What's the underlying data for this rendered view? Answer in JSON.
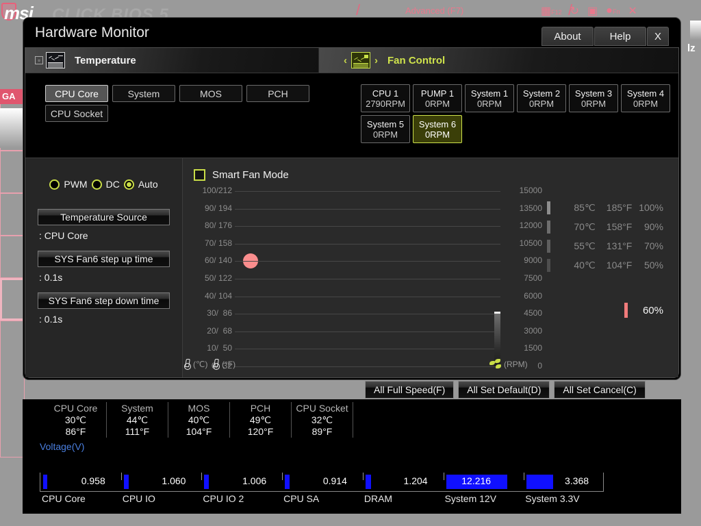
{
  "background": {
    "brand": "msi",
    "brand_sub": "CLICK BIOS 5",
    "advanced_label": "Advanced (F7)",
    "screenshot_key": "F12",
    "fn_label": "Fn",
    "ga_tag": "GA",
    "right_edge_text": "lz"
  },
  "dialog": {
    "title": "Hardware Monitor",
    "buttons": [
      {
        "label": "About",
        "name": "about-button"
      },
      {
        "label": "Help",
        "name": "help-button"
      },
      {
        "label": "X",
        "name": "close-button"
      }
    ]
  },
  "temperature_panel": {
    "header": "Temperature",
    "collapse_glyph": "⊡",
    "tabs": [
      {
        "label": "CPU Core",
        "selected": true
      },
      {
        "label": "System",
        "selected": false
      },
      {
        "label": "MOS",
        "selected": false
      },
      {
        "label": "PCH",
        "selected": false
      },
      {
        "label": "CPU Socket",
        "selected": false
      }
    ]
  },
  "fan_panel": {
    "header": "Fan Control",
    "nav_prev": "‹",
    "nav_next": "›",
    "fans": [
      {
        "name": "CPU 1",
        "rpm": "2790RPM",
        "selected": false
      },
      {
        "name": "PUMP 1",
        "rpm": "0RPM",
        "selected": false
      },
      {
        "name": "System 1",
        "rpm": "0RPM",
        "selected": false
      },
      {
        "name": "System 2",
        "rpm": "0RPM",
        "selected": false
      },
      {
        "name": "System 3",
        "rpm": "0RPM",
        "selected": false
      },
      {
        "name": "System 4",
        "rpm": "0RPM",
        "selected": false
      },
      {
        "name": "System 5",
        "rpm": "0RPM",
        "selected": false
      },
      {
        "name": "System 6",
        "rpm": "0RPM",
        "selected": true
      }
    ]
  },
  "controls": {
    "modes": [
      {
        "label": "PWM",
        "selected": false
      },
      {
        "label": "DC",
        "selected": false
      },
      {
        "label": "Auto",
        "selected": true
      }
    ],
    "fields": [
      {
        "label": "Temperature Source",
        "value": ": CPU Core"
      },
      {
        "label": "SYS Fan6 step up time",
        "value": ": 0.1s"
      },
      {
        "label": "SYS Fan6 step down time",
        "value": ": 0.1s"
      }
    ],
    "smart_fan_mode": {
      "label": "Smart Fan Mode",
      "checked": false
    }
  },
  "chart_data": {
    "type": "line",
    "title": "",
    "xlabel": "",
    "ylabel": "",
    "grid": true,
    "y_left_label": "°C / °F",
    "y_right_label": "RPM",
    "y_left_ticks": [
      "100/212",
      "90/ 194",
      "80/ 176",
      "70/ 158",
      "60/ 140",
      "50/ 122",
      "40/ 104",
      "30/  86",
      "20/  68",
      "10/  50",
      "0/  32"
    ],
    "y_left_celsius": [
      100,
      90,
      80,
      70,
      60,
      50,
      40,
      30,
      20,
      10,
      0
    ],
    "y_left_fahrenheit": [
      212,
      194,
      176,
      158,
      140,
      122,
      104,
      86,
      68,
      50,
      32
    ],
    "y_right_ticks": [
      "15000",
      "13500",
      "12000",
      "10500",
      "9000",
      "7500",
      "6000",
      "4500",
      "3000",
      "1500",
      "0"
    ],
    "y_right_values": [
      15000,
      13500,
      12000,
      10500,
      9000,
      7500,
      6000,
      4500,
      3000,
      1500,
      0
    ],
    "ylim": [
      0,
      100
    ],
    "rpm_lim": [
      0,
      15000
    ],
    "points": [
      {
        "label": "current",
        "temp_c": 60,
        "temp_f": 140,
        "color": "#fa8d8d"
      }
    ],
    "rpm_indicator": {
      "value": 4500,
      "max": 15000,
      "color": "#6e6e6e"
    },
    "axis_icons": [
      {
        "icon": "thermometer-icon",
        "label": "(℃)"
      },
      {
        "icon": "thermometer-icon",
        "label": "(°F)"
      },
      {
        "icon": "fan-icon",
        "label": "(RPM)"
      }
    ]
  },
  "curve_legend": {
    "rows": [
      {
        "celsius": "85℃",
        "fahrenheit": "185°F",
        "percent": "100%",
        "bar_color": "#8e8e8e"
      },
      {
        "celsius": "70℃",
        "fahrenheit": "158°F",
        "percent": "90%",
        "bar_color": "#6e6e6e"
      },
      {
        "celsius": "55℃",
        "fahrenheit": "131°F",
        "percent": "70%",
        "bar_color": "#5e5e5e"
      },
      {
        "celsius": "40℃",
        "fahrenheit": "104°F",
        "percent": "50%",
        "bar_color": "#4e4e4e"
      }
    ],
    "current": {
      "percent": "60%",
      "bar_color": "#f07b7b"
    }
  },
  "footer_buttons": [
    {
      "label": "All Full Speed(F)",
      "name": "all-full-speed-button"
    },
    {
      "label": "All Set Default(D)",
      "name": "all-set-default-button"
    },
    {
      "label": "All Set Cancel(C)",
      "name": "all-set-cancel-button"
    }
  ],
  "temperature_readouts": [
    {
      "name": "CPU Core",
      "celsius": "30℃",
      "fahrenheit": "86°F"
    },
    {
      "name": "System",
      "celsius": "44℃",
      "fahrenheit": "111°F"
    },
    {
      "name": "MOS",
      "celsius": "40℃",
      "fahrenheit": "104°F"
    },
    {
      "name": "PCH",
      "celsius": "49℃",
      "fahrenheit": "120°F"
    },
    {
      "name": "CPU Socket",
      "celsius": "32℃",
      "fahrenheit": "89°F"
    }
  ],
  "voltage": {
    "title": "Voltage(V)",
    "bar_color": "#1010ff",
    "items": [
      {
        "name": "CPU Core",
        "value": "0.958",
        "fill": 0.06
      },
      {
        "name": "CPU IO",
        "value": "1.060",
        "fill": 0.07
      },
      {
        "name": "CPU IO 2",
        "value": "1.006",
        "fill": 0.065
      },
      {
        "name": "CPU SA",
        "value": "0.914",
        "fill": 0.06
      },
      {
        "name": "DRAM",
        "value": "1.204",
        "fill": 0.075
      },
      {
        "name": "System 12V",
        "value": "12.216",
        "fill": 0.83
      },
      {
        "name": "System 3.3V",
        "value": "3.368",
        "fill": 0.36
      }
    ]
  }
}
